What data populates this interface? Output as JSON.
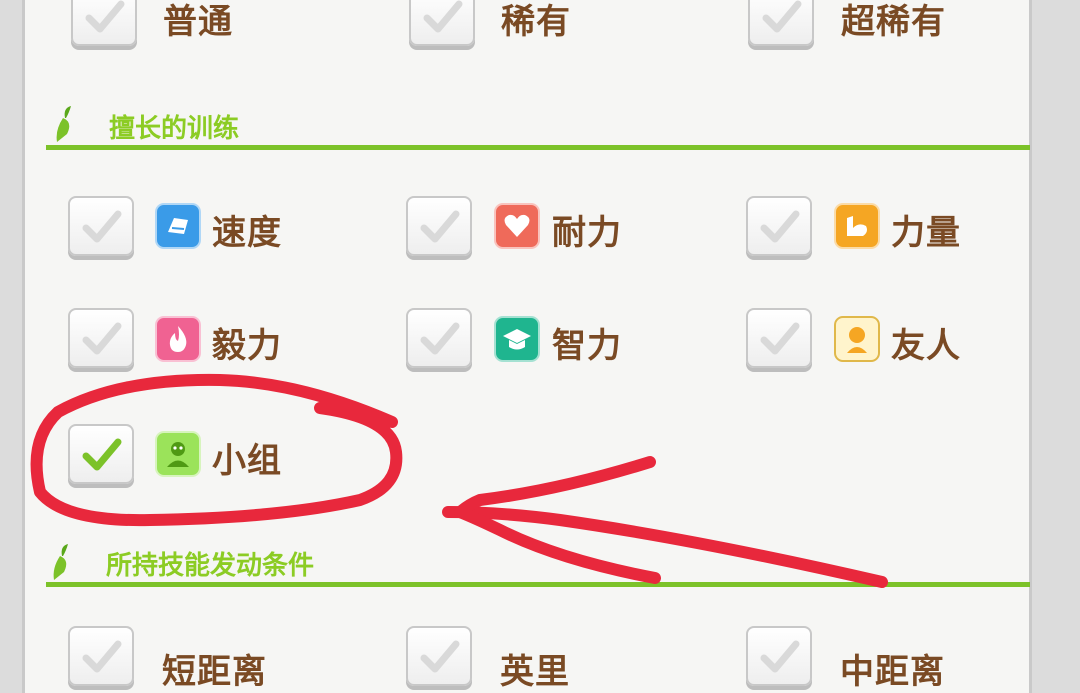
{
  "rarity": {
    "normal": "普通",
    "rare": "稀有",
    "super_rare": "超稀有"
  },
  "training_section": {
    "title": "擅长的训练",
    "items": {
      "speed": "速度",
      "stamina": "耐力",
      "power": "力量",
      "guts": "毅力",
      "wisdom": "智力",
      "friend": "友人",
      "group": "小组"
    },
    "checked": [
      "小组"
    ]
  },
  "skill_section": {
    "title": "所持技能发动条件",
    "items": {
      "short": "短距离",
      "mile": "英里",
      "medium": "中距离"
    }
  },
  "colors": {
    "accent_green": "#7cc229",
    "label_brown": "#7a4a24",
    "annotation_red": "#e8283c",
    "speed_icon": "#3a9be8",
    "stamina_icon": "#ef6a5a",
    "power_icon": "#f5a623",
    "guts_icon": "#f06292",
    "wisdom_icon": "#1fb58f",
    "friend_icon": "#f7c948",
    "group_icon": "#7ed321"
  }
}
